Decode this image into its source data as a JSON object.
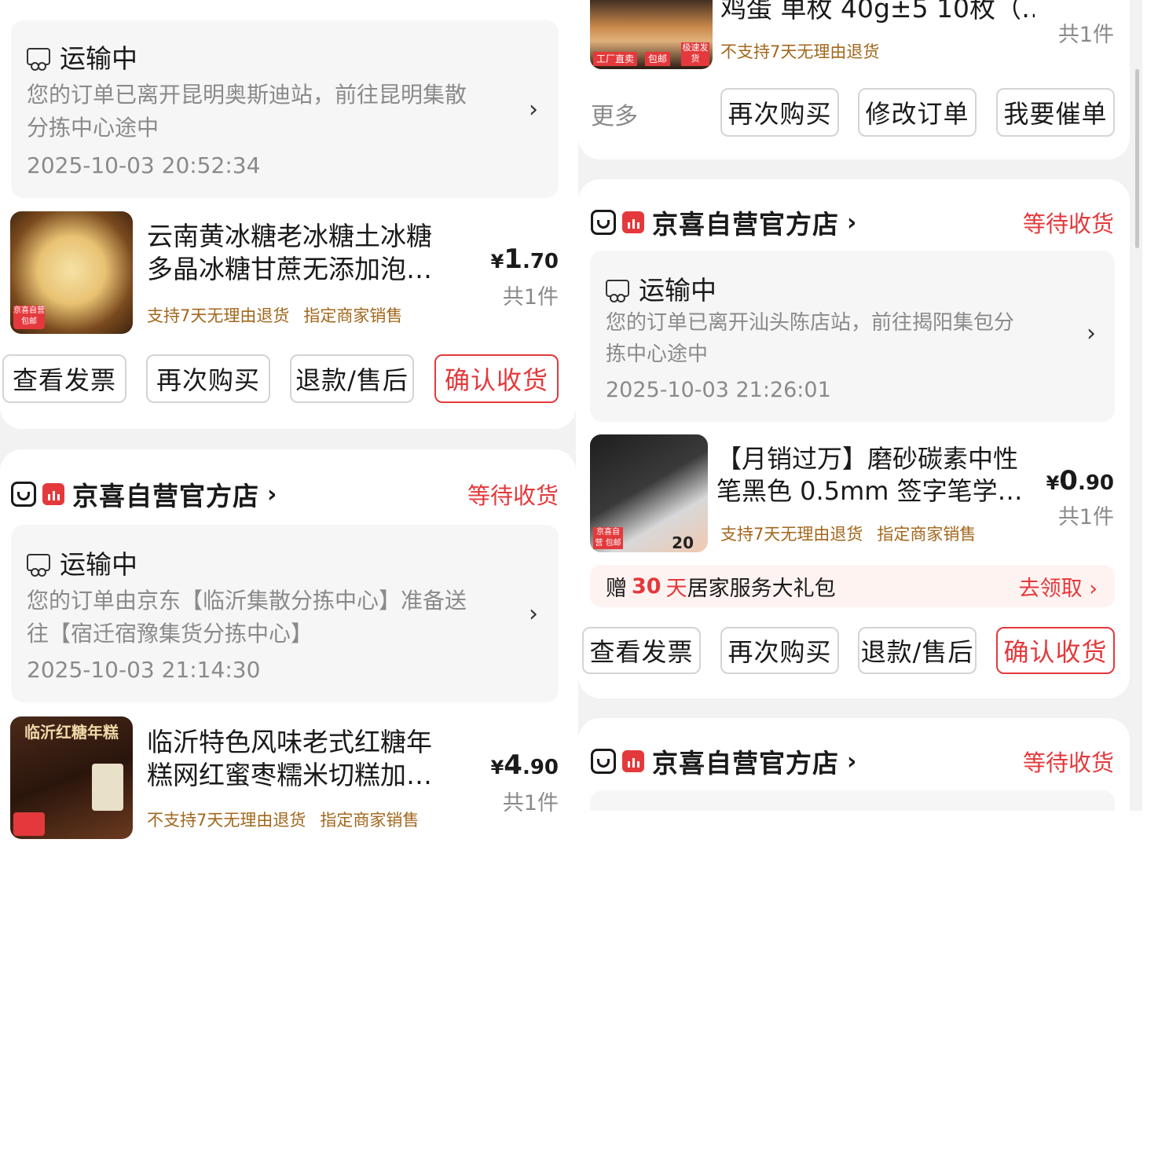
{
  "left": {
    "order1": {
      "shipping": {
        "status": "运输中",
        "desc_line1": "您的订单已离开昆明奥斯迪站，前往昆明集散",
        "desc_line2": "分拣中心途中",
        "time": "2025-10-03 20:52:34"
      },
      "product": {
        "title_line1": "云南黄冰糖老冰糖土冰糖",
        "title_line2": "多晶冰糖甘蔗无添加泡…",
        "tag1": "支持7天无理由退货",
        "tag2": "指定商家销售",
        "price_yen": "¥",
        "price_int": "1",
        "price_dec": ".70",
        "qty": "共1件",
        "image_badge": "京喜自营 包邮"
      },
      "buttons": [
        "查看发票",
        "再次购买",
        "退款/售后",
        "确认收货"
      ]
    },
    "order2": {
      "shop_name": "京喜自营官方店",
      "status": "等待收货",
      "shipping": {
        "status": "运输中",
        "desc_line1": "您的订单由京东【临沂集散分拣中心】准备送",
        "desc_line2": "往【宿迁宿豫集货分拣中心】",
        "time": "2025-10-03 21:14:30"
      },
      "product": {
        "title_line1": "临沂特色风味老式红糖年",
        "title_line2": "糕网红蜜枣糯米切糕加…",
        "tag1": "不支持7天无理由退货",
        "tag2": "指定商家销售",
        "price_yen": "¥",
        "price_int": "4",
        "price_dec": ".90",
        "qty": "共1件",
        "image_text": "临沂红糖年糕"
      }
    }
  },
  "right": {
    "order_top": {
      "product": {
        "title": "鸡蛋 单枚 40g±5 10枚（…",
        "tag1": "不支持7天无理由退货",
        "qty": "共1件",
        "image_badges": [
          "工厂直卖",
          "包邮",
          "极速发货"
        ]
      },
      "more": "更多",
      "buttons": [
        "再次购买",
        "修改订单",
        "我要催单"
      ]
    },
    "order_mid": {
      "shop_name": "京喜自营官方店",
      "status": "等待收货",
      "shipping": {
        "status": "运输中",
        "desc_line1": "您的订单已离开汕头陈店站，前往揭阳集包分",
        "desc_line2": "拣中心途中",
        "time": "2025-10-03 21:26:01"
      },
      "product": {
        "title_line1": "【月销过万】磨砂碳素中性",
        "title_line2": "笔黑色 0.5mm 签字笔学…",
        "tag1": "支持7天无理由退货",
        "tag2": "指定商家销售",
        "price_yen": "¥",
        "price_int": "0",
        "price_dec": ".90",
        "qty": "共1件",
        "image_badge": "京喜自营 包邮",
        "image_count": "20"
      },
      "gift": {
        "prefix": "赠",
        "days": "30",
        "unit": "天",
        "text": "居家服务大礼包",
        "claim": "去领取 ›"
      },
      "buttons": [
        "查看发票",
        "再次购买",
        "退款/售后",
        "确认收货"
      ]
    },
    "order_bottom": {
      "shop_name": "京喜自营官方店",
      "status": "等待收货"
    }
  },
  "colors": {
    "accent": "#e4393c",
    "tag": "#a2671c",
    "muted": "#8a8a8a",
    "page_bg": "#f2f2f2"
  },
  "icons": [
    "shop-icon",
    "jd-logo-icon",
    "truck-icon",
    "chevron-right-icon"
  ]
}
